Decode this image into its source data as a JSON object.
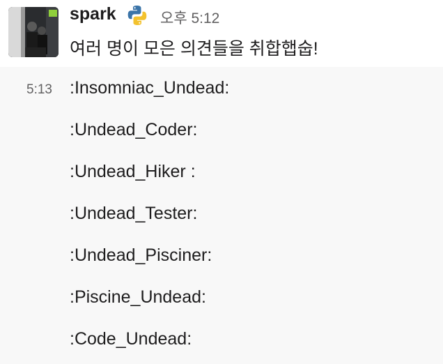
{
  "message": {
    "username": "spark",
    "status_emoji": "python-icon",
    "timestamp": "오후 5:12",
    "text": "여러 명이 모은 의견들을 취합햅숩!"
  },
  "followup": {
    "time": "5:13",
    "lines": [
      ":Insomniac_Undead:",
      ":Undead_Coder:",
      ":Undead_Hiker :",
      ":Undead_Tester:",
      ":Undead_Pisciner:",
      ":Piscine_Undead:",
      ":Code_Undead:"
    ]
  },
  "colors": {
    "python_blue": "#3b74a8",
    "python_yellow": "#f3c22e",
    "thread_bg": "#f8f8f8"
  }
}
